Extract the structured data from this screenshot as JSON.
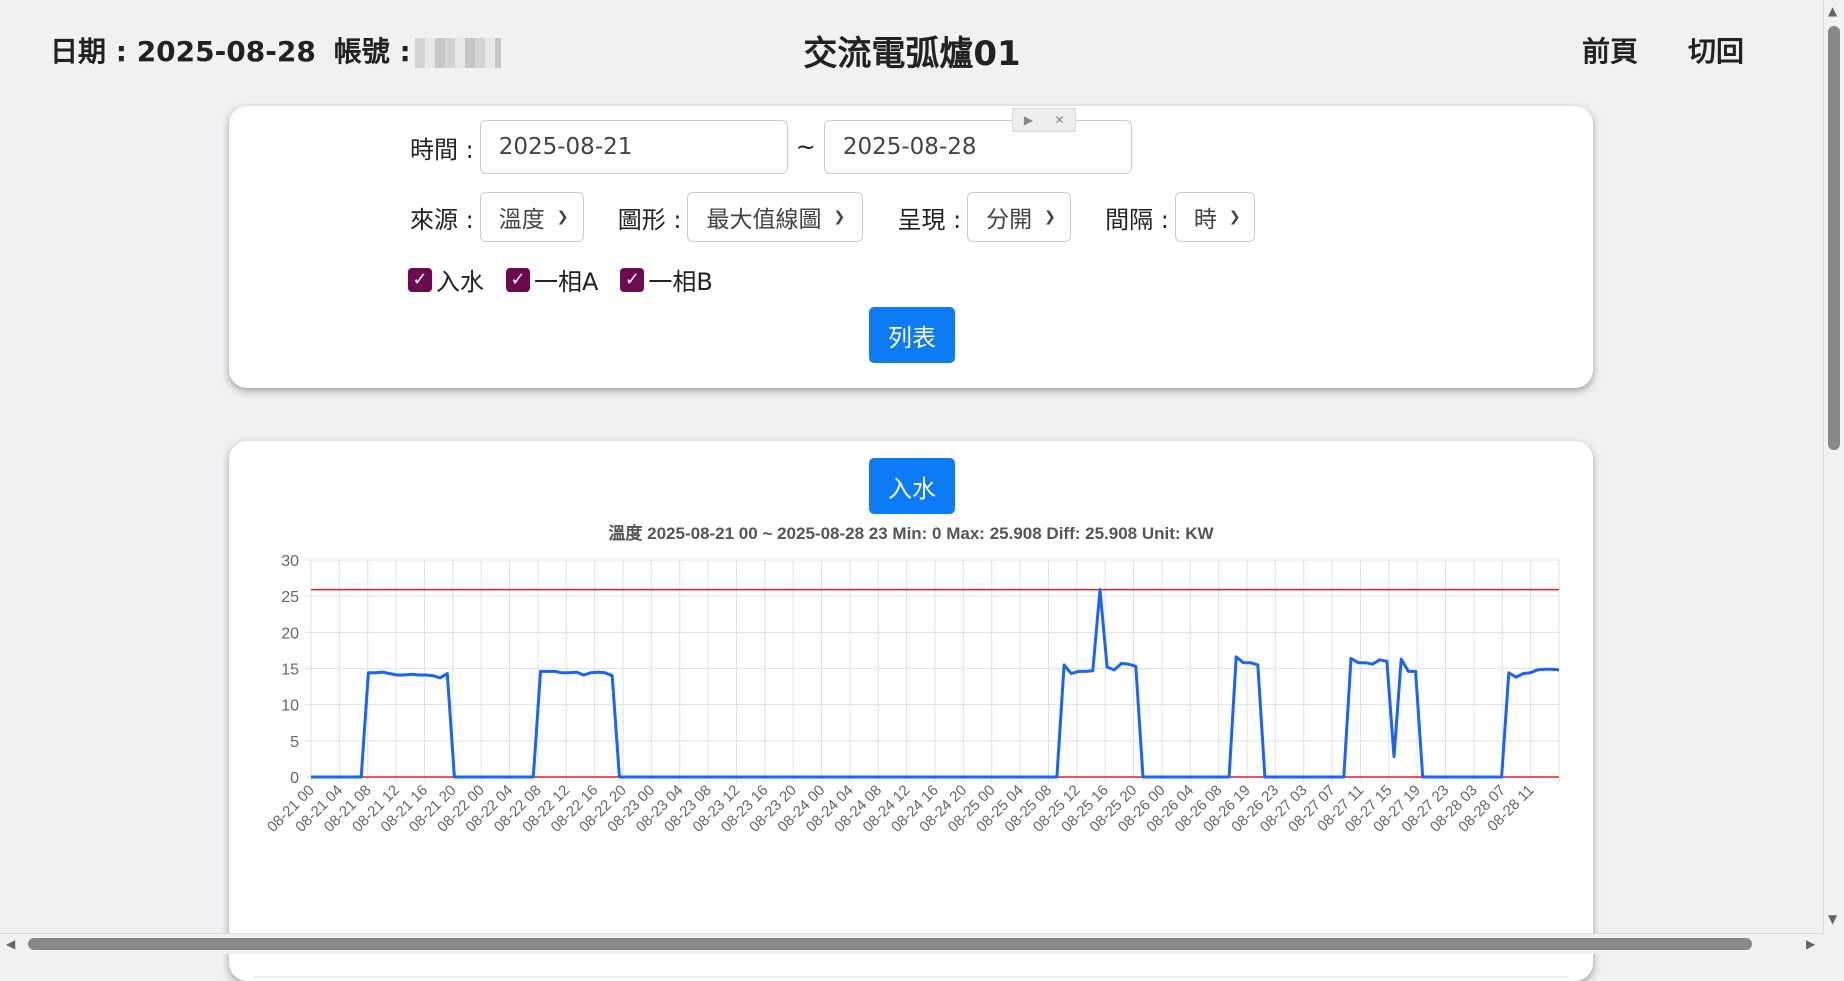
{
  "header": {
    "date_label": "日期 : 2025-08-28",
    "account_label": "帳號 :",
    "title": "交流電弧爐01",
    "nav_prev": "前頁",
    "nav_switch": "切回"
  },
  "filter": {
    "time_label": "時間 :",
    "start_date": "2025-08-21",
    "separator": "~",
    "end_date": "2025-08-28",
    "source_label": "來源 :",
    "source_value": "溫度",
    "chart_label": "圖形 :",
    "chart_value": "最大值線圖",
    "display_label": "呈現 :",
    "display_value": "分開",
    "interval_label": "間隔 :",
    "interval_value": "時",
    "checkboxes": [
      "入水",
      "一相A",
      "一相B"
    ],
    "list_button": "列表"
  },
  "panel": {
    "series_button": "入水"
  },
  "chart_data": {
    "type": "line",
    "title": "溫度 2025-08-21 00 ~ 2025-08-28 23  Min: 0 Max: 25.908 Diff: 25.908 Unit: KW",
    "ylim": [
      0,
      30
    ],
    "yticks": [
      0,
      5,
      10,
      15,
      20,
      25,
      30
    ],
    "x_tick_labels": [
      "08-21 00",
      "08-21 04",
      "08-21 08",
      "08-21 12",
      "08-21 16",
      "08-21 20",
      "08-22 00",
      "08-22 04",
      "08-22 08",
      "08-22 12",
      "08-22 16",
      "08-22 20",
      "08-23 00",
      "08-23 04",
      "08-23 08",
      "08-23 12",
      "08-23 16",
      "08-23 20",
      "08-24 00",
      "08-24 04",
      "08-24 08",
      "08-24 12",
      "08-24 16",
      "08-24 20",
      "08-25 00",
      "08-25 04",
      "08-25 08",
      "08-25 12",
      "08-25 16",
      "08-25 20",
      "08-26 00",
      "08-26 04",
      "08-26 08",
      "08-26 19",
      "08-26 23",
      "08-27 03",
      "08-27 07",
      "08-27 11",
      "08-27 15",
      "08-27 19",
      "08-27 23",
      "08-28 03",
      "08-28 07",
      "08-28 11"
    ],
    "grid": true,
    "reference_lines": [
      {
        "value": 25.908,
        "color": "#e02020"
      },
      {
        "value": 0,
        "color": "#e02020"
      }
    ],
    "series": [
      {
        "color": "#1a66f0",
        "points": [
          [
            0,
            0
          ],
          [
            1,
            0
          ],
          [
            2,
            0
          ],
          [
            3,
            0
          ],
          [
            4,
            0
          ],
          [
            5,
            0
          ],
          [
            6,
            0
          ],
          [
            7,
            0
          ],
          [
            8,
            14.4
          ],
          [
            9,
            14.4
          ],
          [
            10,
            14.5
          ],
          [
            11,
            14.3
          ],
          [
            12,
            14.1
          ],
          [
            13,
            14.1
          ],
          [
            14,
            14.2
          ],
          [
            15,
            14.1
          ],
          [
            16,
            14.1
          ],
          [
            17,
            14.0
          ],
          [
            18,
            13.7
          ],
          [
            19,
            14.3
          ],
          [
            20,
            0
          ],
          [
            21,
            0
          ],
          [
            22,
            0
          ],
          [
            23,
            0
          ],
          [
            24,
            0
          ],
          [
            25,
            0
          ],
          [
            26,
            0
          ],
          [
            27,
            0
          ],
          [
            28,
            0
          ],
          [
            29,
            0
          ],
          [
            30,
            0
          ],
          [
            31,
            0
          ],
          [
            32,
            14.6
          ],
          [
            33,
            14.6
          ],
          [
            34,
            14.6
          ],
          [
            35,
            14.4
          ],
          [
            36,
            14.4
          ],
          [
            37,
            14.5
          ],
          [
            38,
            14.1
          ],
          [
            39,
            14.4
          ],
          [
            40,
            14.5
          ],
          [
            41,
            14.4
          ],
          [
            42,
            14.0
          ],
          [
            43,
            0
          ],
          [
            104,
            0
          ],
          [
            105,
            15.5
          ],
          [
            106,
            14.3
          ],
          [
            107,
            14.6
          ],
          [
            108,
            14.6
          ],
          [
            109,
            14.7
          ],
          [
            110,
            25.908
          ],
          [
            111,
            15.2
          ],
          [
            112,
            14.8
          ],
          [
            113,
            15.7
          ],
          [
            114,
            15.6
          ],
          [
            115,
            15.3
          ],
          [
            116,
            0
          ],
          [
            128,
            0
          ],
          [
            129,
            16.6
          ],
          [
            130,
            15.8
          ],
          [
            131,
            15.8
          ],
          [
            132,
            15.5
          ],
          [
            133,
            0
          ],
          [
            144,
            0
          ],
          [
            145,
            16.4
          ],
          [
            146,
            15.8
          ],
          [
            147,
            15.8
          ],
          [
            148,
            15.6
          ],
          [
            149,
            16.2
          ],
          [
            150,
            16.0
          ],
          [
            151,
            2.8
          ],
          [
            152,
            16.3
          ],
          [
            153,
            14.6
          ],
          [
            154,
            14.6
          ],
          [
            155,
            0
          ],
          [
            166,
            0
          ],
          [
            167,
            14.4
          ],
          [
            168,
            13.8
          ],
          [
            169,
            14.3
          ],
          [
            170,
            14.4
          ],
          [
            171,
            14.8
          ],
          [
            172,
            14.9
          ],
          [
            173,
            14.9
          ],
          [
            174,
            14.8
          ]
        ]
      }
    ]
  }
}
